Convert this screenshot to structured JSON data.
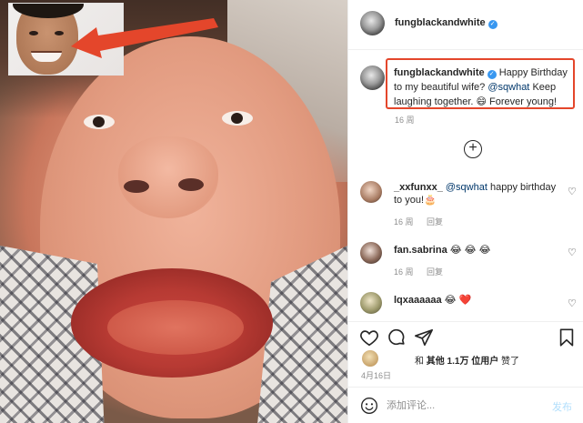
{
  "post": {
    "author": "fungblackandwhite",
    "verified_icon": "verified-badge-icon",
    "caption": {
      "username": "fungblackandwhite",
      "text_1": "Happy Birthday to my beautiful wife?",
      "mention": "@sqwhat",
      "text_2": "Keep laughing together. 😄  Forever young!",
      "time": "16 周"
    },
    "highlight_color": "#e4462b"
  },
  "comments": [
    {
      "username": "_xxfunxx_",
      "mention": "@sqwhat",
      "text": "happy birthday to you!🎂",
      "time": "16 周",
      "reply": "回复"
    },
    {
      "username": "fan.sabrina",
      "text": "😂 😂 😂",
      "time": "16 周",
      "reply": "回复"
    },
    {
      "username": "lqxaaaaaa",
      "text": "😂 ❤️"
    }
  ],
  "actions": {
    "icons": [
      "heart-outline-icon",
      "comment-icon",
      "share-icon",
      "bookmark-icon"
    ]
  },
  "likes": {
    "prefix": "和",
    "count": "其他 1.1万 位用户",
    "suffix": "赞了"
  },
  "date": "4月16日",
  "add_comment": {
    "placeholder": "添加评论...",
    "post_label": "发布"
  },
  "colors": {
    "link": "#00376b",
    "muted": "#8e8e8e",
    "verified": "#3897f0",
    "arrow": "#e4462b"
  }
}
